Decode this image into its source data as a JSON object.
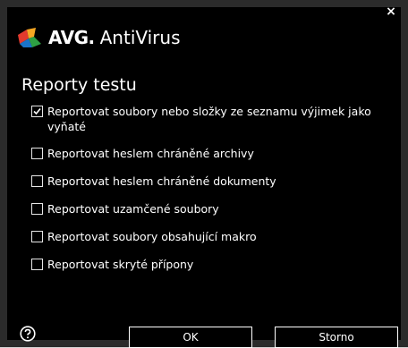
{
  "window": {
    "close_glyph": "×",
    "close_icon": "close-icon"
  },
  "logo": {
    "brand": "AVG.",
    "product": "AntiVirus",
    "mark_icon": "avg-logo-icon",
    "colors": [
      "#e23a2e",
      "#f5a623",
      "#2ea043",
      "#1a73c8"
    ]
  },
  "heading": "Reporty testu",
  "options": [
    {
      "label": "Reportovat soubory nebo složky ze seznamu výjimek jako vyňaté",
      "checked": true
    },
    {
      "label": "Reportovat heslem chráněné archivy",
      "checked": false
    },
    {
      "label": "Reportovat heslem chráněné dokumenty",
      "checked": false
    },
    {
      "label": "Reportovat uzamčené soubory",
      "checked": false
    },
    {
      "label": "Reportovat soubory obsahující makro",
      "checked": false
    },
    {
      "label": "Reportovat skryté přípony",
      "checked": false
    }
  ],
  "footer": {
    "help_icon": "help-icon",
    "ok_label": "OK",
    "cancel_label": "Storno"
  }
}
